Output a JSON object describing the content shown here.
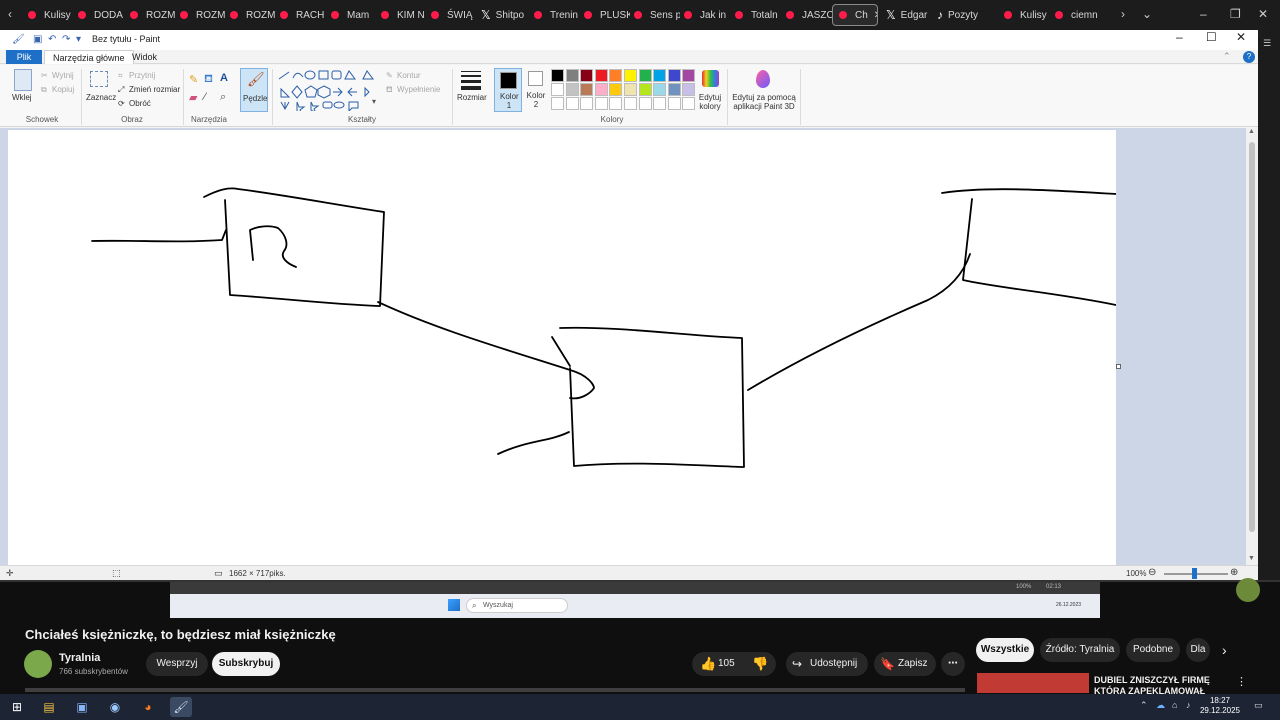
{
  "browser": {
    "tabs": [
      {
        "label": "Kulisy",
        "kind": "yt"
      },
      {
        "label": "DODA",
        "kind": "yt"
      },
      {
        "label": "ROZM",
        "kind": "yt"
      },
      {
        "label": "ROZM",
        "kind": "yt"
      },
      {
        "label": "ROZM",
        "kind": "yt"
      },
      {
        "label": "RACH",
        "kind": "yt"
      },
      {
        "label": "Mam",
        "kind": "yt"
      },
      {
        "label": "KIM N",
        "kind": "yt"
      },
      {
        "label": "ŚWIĄ",
        "kind": "yt"
      },
      {
        "label": "Shitpo",
        "kind": "x"
      },
      {
        "label": "Trenin",
        "kind": "yt"
      },
      {
        "label": "PLUSK",
        "kind": "yt"
      },
      {
        "label": "Sens p",
        "kind": "yt"
      },
      {
        "label": "Jak in",
        "kind": "yt"
      },
      {
        "label": "Totaln",
        "kind": "yt"
      },
      {
        "label": "JASZC",
        "kind": "yt"
      },
      {
        "label": "Ch",
        "kind": "yt",
        "active": true
      },
      {
        "label": "Edgar",
        "kind": "x"
      },
      {
        "label": "Pozyty",
        "kind": "tt"
      },
      {
        "label": "Kulisy",
        "kind": "yt"
      },
      {
        "label": "ciemn",
        "kind": "yt"
      }
    ],
    "accent": "#ff1c4a"
  },
  "paint": {
    "window_title": "Bez tytułu - Paint",
    "file_tab": "Plik",
    "ribbon_tabs": [
      "Narzędzia główne",
      "Widok"
    ],
    "clipboard": {
      "paste": "Wklej",
      "cut": "Wytnij",
      "copy": "Kopiuj",
      "group": "Schowek"
    },
    "image": {
      "select": "Zaznacz",
      "crop": "Przytnij",
      "resize": "Zmień rozmiar",
      "rotate": "Obróć",
      "group": "Obraz"
    },
    "tools_group": "Narzędzia",
    "brushes": "Pędzle",
    "shapes": {
      "outline": "Kontur",
      "fill": "Wypełnienie",
      "group": "Kształty"
    },
    "size": "Rozmiar",
    "color1": "Kolor 1",
    "color2": "Kolor 2",
    "colors_group": "Kolory",
    "edit_colors": "Edytuj kolory",
    "paint3d": "Edytuj za pomocą aplikacji Paint 3D",
    "palette_row1": [
      "#000000",
      "#7f7f7f",
      "#880015",
      "#ed1c24",
      "#ff7f27",
      "#fff200",
      "#22b14c",
      "#00a2e8",
      "#3f48cc",
      "#a349a4"
    ],
    "palette_row2": [
      "#ffffff",
      "#c3c3c3",
      "#b97a57",
      "#ffaec9",
      "#ffc90e",
      "#efe4b0",
      "#b5e61d",
      "#99d9ea",
      "#7092be",
      "#c8bfe7"
    ],
    "status_dimensions": "1662 × 717piks.",
    "zoom": "100%"
  },
  "inner_taskbar": {
    "search": "Wyszukaj",
    "time": "02:13",
    "date": "26.12.2023"
  },
  "video": {
    "title": "Chciałeś księżniczkę, to będziesz miał księżniczkę",
    "channel": "Tyralnia",
    "subscribers": "766 subskrybentów",
    "support": "Wesprzyj",
    "subscribe": "Subskrybuj",
    "likes": "105",
    "share": "Udostępnij",
    "save": "Zapisz",
    "filters": [
      "Wszystkie",
      "Źródło: Tyralnia",
      "Podobne",
      "Dla"
    ],
    "recommendation": "DUBIEL ZNISZCZYŁ FIRMĘ KTÓRA ZAPEKLAMOWAŁ"
  },
  "os": {
    "time": "18:27",
    "date": "29.12.2025"
  }
}
